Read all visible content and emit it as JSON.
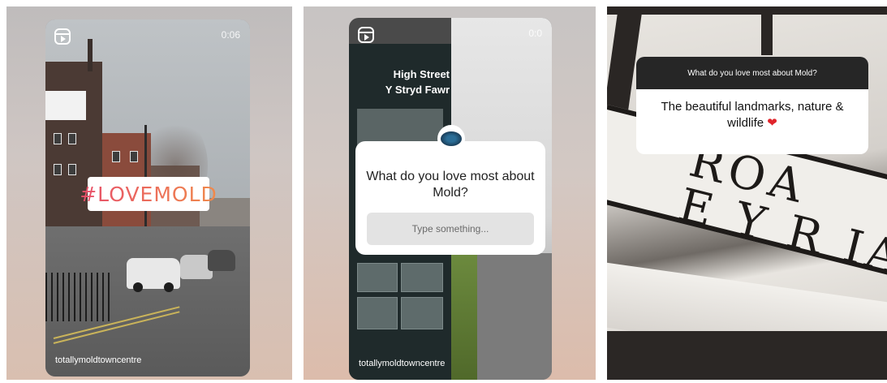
{
  "panel1": {
    "time": "0:06",
    "hashtag": "#LOVEMOLD",
    "account": "totallymoldtowncentre"
  },
  "panel2": {
    "time": "0:0",
    "sign_title_line1": "High Street",
    "sign_title_line2": "Y Stryd Fawr",
    "question": "What do you love most about Mold?",
    "input_placeholder": "Type something...",
    "account": "totallymoldtowncentre"
  },
  "panel3": {
    "question": "What do you love most about Mold?",
    "answer": "The beautiful landmarks, nature & wildlife",
    "answer_emoji": "❤",
    "sign_letters_line1": "ROA",
    "sign_letters_line2": "E Y R IA"
  },
  "icons": [
    "reels-icon",
    "heart-icon",
    "profile-avatar"
  ],
  "colors": {
    "hashtag_start": "#e74f6b",
    "hashtag_end": "#f08a4b",
    "answer_header_bg": "#262626",
    "heart": "#e0242b"
  }
}
